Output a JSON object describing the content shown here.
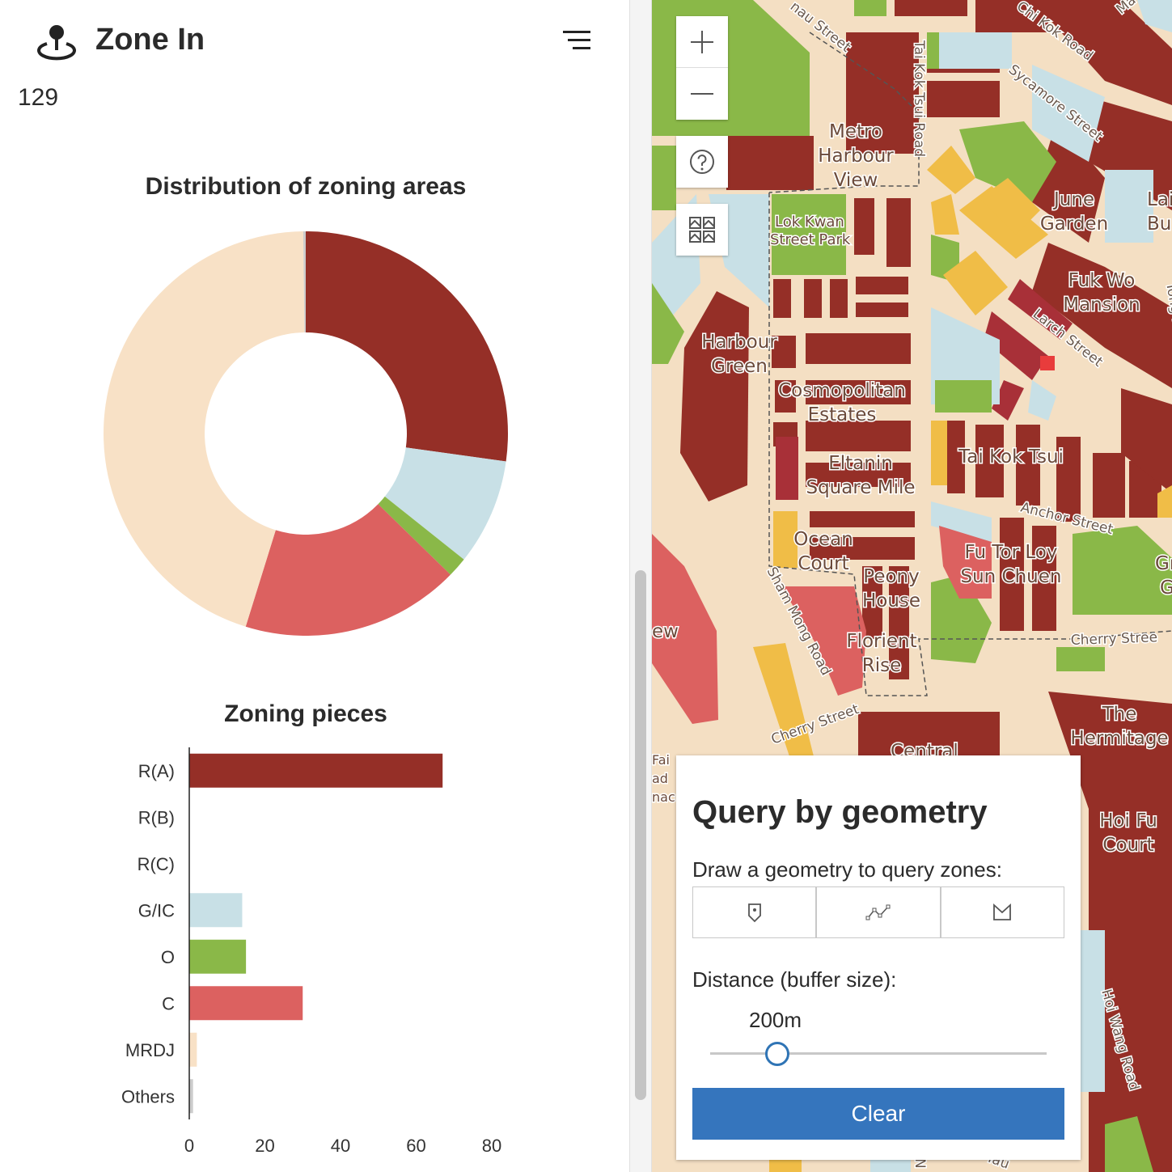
{
  "header": {
    "title": "Zone In",
    "count": "129"
  },
  "donut_chart": {
    "title": "Distribution of zoning areas",
    "slices": [
      {
        "zone": "R(A)",
        "fraction": 0.272,
        "color": "#952f27"
      },
      {
        "zone": "G/IC",
        "fraction": 0.085,
        "color": "#c8e0e6"
      },
      {
        "zone": "O",
        "fraction": 0.016,
        "color": "#8ab848"
      },
      {
        "zone": "C",
        "fraction": 0.175,
        "color": "#dc6160"
      },
      {
        "zone": "MRDJ",
        "fraction": 0.45,
        "color": "#f8e1c6"
      },
      {
        "zone": "Others",
        "fraction": 0.002,
        "color": "#cccccc"
      }
    ]
  },
  "chart_data": {
    "type": "bar",
    "title": "Zoning pieces",
    "categories": [
      "R(A)",
      "R(B)",
      "R(C)",
      "G/IC",
      "O",
      "C",
      "MRDJ",
      "Others"
    ],
    "values": [
      67,
      0,
      0,
      14,
      15,
      30,
      2,
      1
    ],
    "colors": [
      "#952f27",
      "#952f27",
      "#952f27",
      "#c8e0e6",
      "#8ab848",
      "#dc6160",
      "#f8e1c6",
      "#cccccc"
    ],
    "xlim": [
      0,
      80
    ],
    "xticks": [
      "0",
      "20",
      "40",
      "60",
      "80"
    ],
    "orientation": "horizontal"
  },
  "map": {
    "labels": {
      "metro_harbour_view": [
        "Metro",
        "Harbour",
        "View"
      ],
      "june_garden": [
        "June",
        "Garden"
      ],
      "lok_kwan_park": [
        "Lok Kwan",
        "Street Park"
      ],
      "fuk_wo_mansion": [
        "Fuk Wo",
        "Mansion"
      ],
      "harbour_green": [
        "Harbour",
        "Green"
      ],
      "cosmopolitan_estates": [
        "Cosmopolitan",
        "Estates"
      ],
      "eltanin_square_mile": [
        "Eltanin",
        "Square Mile"
      ],
      "tai_kok_tsui": "Tai Kok Tsui",
      "ocean_court": [
        "Ocean",
        "Court"
      ],
      "peony_house": [
        "Peony",
        "House"
      ],
      "fu_tor_loy": [
        "Fu Tor Loy",
        "Sun Chuen"
      ],
      "florient_rise": [
        "Florient",
        "Rise"
      ],
      "the_hermitage": [
        "The",
        "Hermitage"
      ],
      "hoi_fu_court": [
        "Hoi Fu",
        "Court"
      ],
      "central": "Central",
      "lai": [
        "Lai",
        "Bu"
      ],
      "gre": [
        "Gre",
        "G"
      ],
      "ew": "ew",
      "fai": [
        "Fai",
        "ad",
        "nac"
      ]
    },
    "streets": {
      "chi_kok": "Chi Kok Road",
      "sycamore": "Sycamore Street",
      "tai_kok_tsui_road": "Tai Kok Tsui Road",
      "larch": "Larch Street",
      "anchor": "Anchor Street",
      "cherry_1": "Cherry Street",
      "cherry_2": "Cherry Stree",
      "sham_mong": "Sham Mong Road",
      "hoi_wang": "Hoi Wang Road",
      "nau": "nau Street",
      "tong": "Tong M",
      "ma": "Ma",
      "yau": "Yau",
      "n": "N"
    },
    "colors": {
      "land": "#f4dfc3",
      "road": "#f8e1c6",
      "residential": "#952f27",
      "commercial": "#dc6160",
      "gic": "#c8e0e6",
      "open_space": "#8ab848",
      "industrial": "#f0bd47",
      "mixed": "#a83038"
    }
  },
  "controls": {
    "zoom_in": "+",
    "zoom_out": "−"
  },
  "query": {
    "title": "Query by geometry",
    "draw_label": "Draw a geometry to query zones:",
    "tools": [
      "point-tool",
      "polyline-tool",
      "polygon-tool"
    ],
    "distance_label": "Distance (buffer size):",
    "distance_value": "200m",
    "distance_fraction": 0.2,
    "clear_label": "Clear"
  }
}
